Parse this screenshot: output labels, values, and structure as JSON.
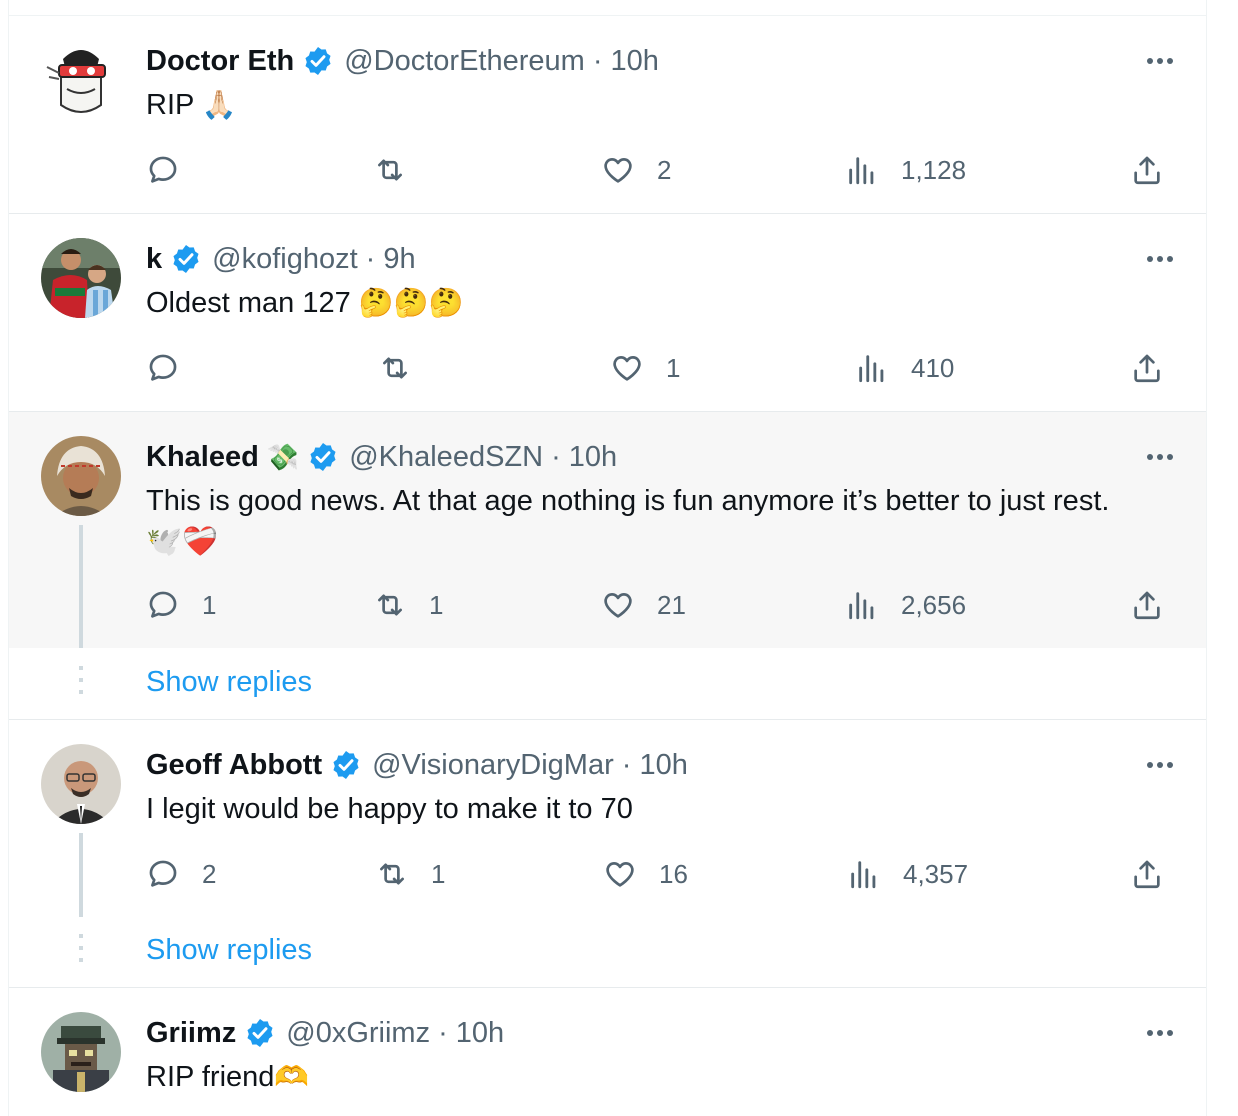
{
  "colors": {
    "verified_badge": "#1d9bf0",
    "link": "#1d9bf0",
    "secondary_text": "#536471",
    "highlight_bg": "#f7f7f7"
  },
  "tweets": [
    {
      "author": "Doctor Eth",
      "name_emoji": "",
      "handle": "@DoctorEthereum",
      "separator": "·",
      "time": "10h",
      "text": "RIP",
      "text_emoji": "🙏🏻",
      "verified": true,
      "avatar_icon": "cartoon-pepe-avatar-icon",
      "reply_count": "",
      "retweet_count": "",
      "like_count": "2",
      "view_count": "1,128"
    },
    {
      "author": "k",
      "name_emoji": "",
      "handle": "@kofighozt",
      "separator": "·",
      "time": "9h",
      "text": "Oldest man 127",
      "text_emoji": "🤔🤔🤔",
      "verified": true,
      "avatar_icon": "football-players-avatar-icon",
      "reply_count": "",
      "retweet_count": "",
      "like_count": "1",
      "view_count": "410"
    },
    {
      "author": "Khaleed",
      "name_emoji": "💸",
      "handle": "@KhaleedSZN",
      "separator": "·",
      "time": "10h",
      "text": "This is good news. At that age nothing is fun anymore it’s better to just rest.",
      "text_line2": "🕊️❤️‍🩹",
      "verified": true,
      "avatar_icon": "man-headscarf-avatar-icon",
      "reply_count": "1",
      "retweet_count": "1",
      "like_count": "21",
      "view_count": "2,656",
      "show_replies": "Show replies"
    },
    {
      "author": "Geoff Abbott",
      "name_emoji": "",
      "handle": "@VisionaryDigMar",
      "separator": "·",
      "time": "10h",
      "text": "I legit would be happy to make it to 70",
      "verified": true,
      "avatar_icon": "man-suit-avatar-icon",
      "reply_count": "2",
      "retweet_count": "1",
      "like_count": "16",
      "view_count": "4,357",
      "show_replies": "Show replies"
    },
    {
      "author": "Griimz",
      "name_emoji": "",
      "handle": "@0xGriimz",
      "separator": "·",
      "time": "10h",
      "text": "RIP friend",
      "text_emoji": "🫶",
      "verified": true,
      "avatar_icon": "pixel-art-avatar-icon"
    }
  ]
}
